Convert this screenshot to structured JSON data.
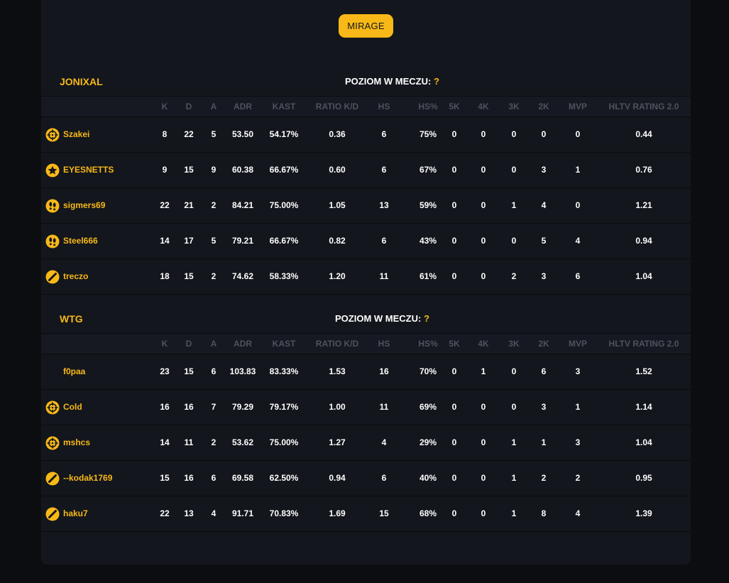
{
  "map_button": "MIRAGE",
  "level_label": "POZIOM W MECZU:",
  "level_value": "?",
  "columns": [
    "K",
    "D",
    "A",
    "ADR",
    "KAST",
    "RATIO K/D",
    "HS",
    "HS%",
    "5K",
    "4K",
    "3K",
    "2K",
    "MVP",
    "HLTV RATING 2.0"
  ],
  "colors": {
    "accent": "#f8b817",
    "panel": "#13161c",
    "background": "#0c0d10"
  },
  "teams": [
    {
      "name": "JONIXAL",
      "players": [
        {
          "icon": "crosshair-icon",
          "name": "Szakei",
          "stats": [
            "8",
            "22",
            "5",
            "53.50",
            "54.17%",
            "0.36",
            "6",
            "75%",
            "0",
            "0",
            "0",
            "0",
            "0",
            "0.44"
          ]
        },
        {
          "icon": "star-icon",
          "name": "EYESNETTS",
          "stats": [
            "9",
            "15",
            "9",
            "60.38",
            "66.67%",
            "0.60",
            "6",
            "67%",
            "0",
            "0",
            "0",
            "3",
            "1",
            "0.76"
          ]
        },
        {
          "icon": "footsteps-icon",
          "name": "sigmers69",
          "stats": [
            "22",
            "21",
            "2",
            "84.21",
            "75.00%",
            "1.05",
            "13",
            "59%",
            "0",
            "0",
            "1",
            "4",
            "0",
            "1.21"
          ]
        },
        {
          "icon": "footsteps-icon",
          "name": "Steel666",
          "stats": [
            "14",
            "17",
            "5",
            "79.21",
            "66.67%",
            "0.82",
            "6",
            "43%",
            "0",
            "0",
            "0",
            "5",
            "4",
            "0.94"
          ]
        },
        {
          "icon": "slash-icon",
          "name": "treczo",
          "stats": [
            "18",
            "15",
            "2",
            "74.62",
            "58.33%",
            "1.20",
            "11",
            "61%",
            "0",
            "0",
            "2",
            "3",
            "6",
            "1.04"
          ]
        }
      ]
    },
    {
      "name": "WTG",
      "players": [
        {
          "icon": "",
          "name": "f0paa",
          "stats": [
            "23",
            "15",
            "6",
            "103.83",
            "83.33%",
            "1.53",
            "16",
            "70%",
            "0",
            "1",
            "0",
            "6",
            "3",
            "1.52"
          ]
        },
        {
          "icon": "crosshair-icon",
          "name": "Cold",
          "stats": [
            "16",
            "16",
            "7",
            "79.29",
            "79.17%",
            "1.00",
            "11",
            "69%",
            "0",
            "0",
            "0",
            "3",
            "1",
            "1.14"
          ]
        },
        {
          "icon": "crosshair-icon",
          "name": "mshcs",
          "stats": [
            "14",
            "11",
            "2",
            "53.62",
            "75.00%",
            "1.27",
            "4",
            "29%",
            "0",
            "0",
            "1",
            "1",
            "3",
            "1.04"
          ]
        },
        {
          "icon": "slash-icon",
          "name": "--kodak1769",
          "stats": [
            "15",
            "16",
            "6",
            "69.58",
            "62.50%",
            "0.94",
            "6",
            "40%",
            "0",
            "0",
            "1",
            "2",
            "2",
            "0.95"
          ]
        },
        {
          "icon": "slash-icon",
          "name": "haku7",
          "stats": [
            "22",
            "13",
            "4",
            "91.71",
            "70.83%",
            "1.69",
            "15",
            "68%",
            "0",
            "0",
            "1",
            "8",
            "4",
            "1.39"
          ]
        }
      ]
    }
  ]
}
